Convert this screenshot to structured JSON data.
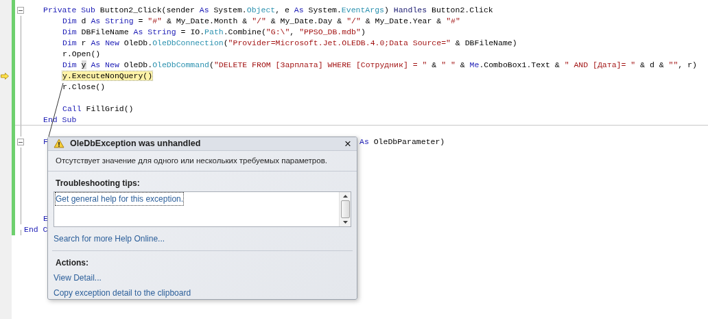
{
  "code": {
    "members": [
      {
        "expanded": true,
        "covered": false,
        "header": [
          {
            "text": "Private Sub",
            "kind": "kw"
          },
          {
            "text": " Button2_Click(sender ",
            "kind": "plain"
          },
          {
            "text": "As",
            "kind": "kw"
          },
          {
            "text": " System.",
            "kind": "plain"
          },
          {
            "text": "Object",
            "kind": "type"
          },
          {
            "text": ", e ",
            "kind": "plain"
          },
          {
            "text": "As",
            "kind": "kw"
          },
          {
            "text": " System.",
            "kind": "plain"
          },
          {
            "text": "EventArgs",
            "kind": "type"
          },
          {
            "text": ") ",
            "kind": "plain"
          },
          {
            "text": "Handles",
            "kind": "kw2"
          },
          {
            "text": " Button2.Click",
            "kind": "plain"
          }
        ],
        "body": [
          {
            "kind": "code",
            "current": false,
            "tokens": [
              {
                "text": "Dim",
                "kind": "kw"
              },
              {
                "text": " d ",
                "kind": "plain"
              },
              {
                "text": "As String",
                "kind": "kw"
              },
              {
                "text": " = ",
                "kind": "plain"
              },
              {
                "text": "\"#\"",
                "kind": "str"
              },
              {
                "text": " & My_Date.Month & ",
                "kind": "plain"
              },
              {
                "text": "\"/\"",
                "kind": "str"
              },
              {
                "text": " & My_Date.Day & ",
                "kind": "plain"
              },
              {
                "text": "\"/\"",
                "kind": "str"
              },
              {
                "text": " & My_Date.Year & ",
                "kind": "plain"
              },
              {
                "text": "\"#\"",
                "kind": "str"
              }
            ]
          },
          {
            "kind": "code",
            "current": false,
            "tokens": [
              {
                "text": "Dim",
                "kind": "kw"
              },
              {
                "text": " DBFileName ",
                "kind": "plain"
              },
              {
                "text": "As String",
                "kind": "kw"
              },
              {
                "text": " = IO.",
                "kind": "plain"
              },
              {
                "text": "Path",
                "kind": "type"
              },
              {
                "text": ".Combine(",
                "kind": "plain"
              },
              {
                "text": "\"G:\\\"",
                "kind": "str"
              },
              {
                "text": ", ",
                "kind": "plain"
              },
              {
                "text": "\"PPSO_DB.mdb\"",
                "kind": "str"
              },
              {
                "text": ")",
                "kind": "plain"
              }
            ]
          },
          {
            "kind": "code",
            "current": false,
            "tokens": [
              {
                "text": "Dim",
                "kind": "kw"
              },
              {
                "text": " r ",
                "kind": "plain"
              },
              {
                "text": "As New",
                "kind": "kw"
              },
              {
                "text": " OleDb.",
                "kind": "plain"
              },
              {
                "text": "OleDbConnection",
                "kind": "type"
              },
              {
                "text": "(",
                "kind": "plain"
              },
              {
                "text": "\"Provider=Microsoft.Jet.OLEDB.4.0;Data Source=\"",
                "kind": "str"
              },
              {
                "text": " & DBFileName)",
                "kind": "plain"
              }
            ]
          },
          {
            "kind": "code",
            "current": false,
            "tokens": [
              {
                "text": "r.Open()",
                "kind": "plain"
              }
            ]
          },
          {
            "kind": "code",
            "current": false,
            "tokens": [
              {
                "text": "Dim ",
                "kind": "kw"
              },
              {
                "text": "y",
                "kind": "ref"
              },
              {
                "text": " As New",
                "kind": "kw"
              },
              {
                "text": " OleDb.",
                "kind": "plain"
              },
              {
                "text": "OleDbCommand",
                "kind": "type"
              },
              {
                "text": "(",
                "kind": "plain"
              },
              {
                "text": "\"DELETE FROM [Зарплата] WHERE [Сотрудник] = \"",
                "kind": "str"
              },
              {
                "text": " & ",
                "kind": "plain"
              },
              {
                "text": "\" \"",
                "kind": "str"
              },
              {
                "text": " & ",
                "kind": "plain"
              },
              {
                "text": "Me",
                "kind": "kw"
              },
              {
                "text": ".ComboBox1.Text & ",
                "kind": "plain"
              },
              {
                "text": "\" AND [Дата]= \"",
                "kind": "str"
              },
              {
                "text": " & d & ",
                "kind": "plain"
              },
              {
                "text": "\"\"",
                "kind": "str"
              },
              {
                "text": ", r)",
                "kind": "plain"
              }
            ]
          },
          {
            "kind": "code",
            "current": true,
            "tokens": [
              {
                "text": "y.ExecuteNonQuery()",
                "kind": "plain"
              }
            ]
          },
          {
            "kind": "code",
            "current": false,
            "tokens": [
              {
                "text": "r.Close()",
                "kind": "plain"
              }
            ]
          },
          {
            "kind": "blank"
          },
          {
            "kind": "code",
            "current": false,
            "tokens": [
              {
                "text": "Call",
                "kind": "kw"
              },
              {
                "text": " FillGrid()",
                "kind": "plain"
              }
            ]
          }
        ],
        "footer": [
          {
            "text": "End Sub",
            "kind": "kw"
          }
        ]
      },
      {
        "expanded": true,
        "covered": true,
        "header": [
          {
            "text": "F",
            "kind": "kw"
          }
        ],
        "tail": [
          {
            "text": "As",
            "kind": "kw"
          },
          {
            "text": " OleDbParameter)",
            "kind": "plain"
          }
        ],
        "footer": [
          {
            "text": "E",
            "kind": "kw"
          }
        ]
      }
    ],
    "closing": [
      {
        "text": "End C",
        "kind": "kw"
      }
    ]
  },
  "dialog": {
    "title": "OleDbException was unhandled",
    "close": "×",
    "message": "Отсутствует значение для одного или нескольких требуемых параметров.",
    "tips_label": "Troubleshooting tips:",
    "tips": [
      "Get general help for this exception."
    ],
    "search_link": "Search for more Help Online...",
    "actions_label": "Actions:",
    "actions": [
      "View Detail...",
      "Copy exception detail to the clipboard"
    ]
  }
}
